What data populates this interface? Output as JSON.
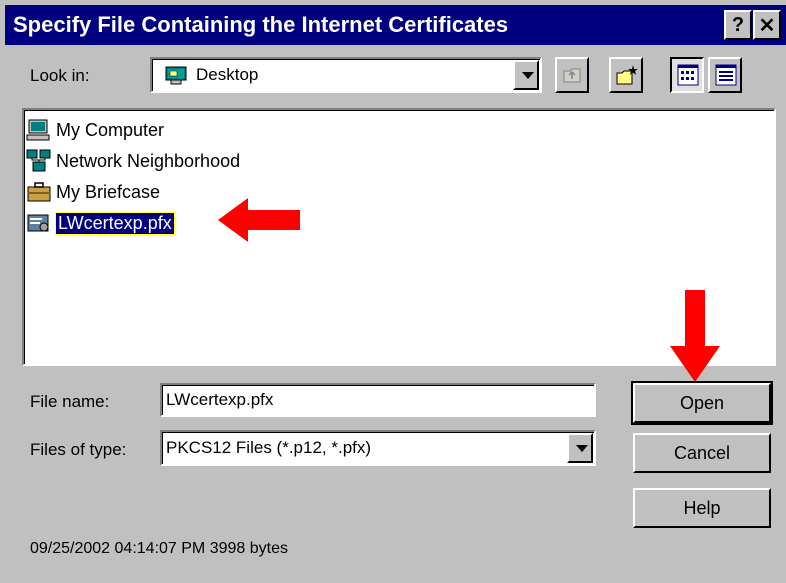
{
  "title": "Specify File Containing the Internet Certificates",
  "title_buttons": {
    "help": "?",
    "close": "✕"
  },
  "look_in": {
    "label": "Look in:",
    "value": "Desktop",
    "icon": "desktop-icon"
  },
  "toolbar": {
    "icons": [
      "up-folder-icon",
      "new-folder-icon",
      "list-view-icon",
      "details-view-icon"
    ]
  },
  "files": [
    {
      "name": "My Computer",
      "icon": "computer-icon"
    },
    {
      "name": "Network Neighborhood",
      "icon": "network-icon"
    },
    {
      "name": "My Briefcase",
      "icon": "briefcase-icon"
    },
    {
      "name": "LWcertexp.pfx",
      "icon": "certificate-icon",
      "selected": true
    }
  ],
  "file_name": {
    "label": "File name:",
    "value": "LWcertexp.pfx"
  },
  "files_of_type": {
    "label": "Files of type:",
    "value": "PKCS12 Files (*.p12, *.pfx)"
  },
  "buttons": {
    "open": "Open",
    "cancel": "Cancel",
    "help": "Help"
  },
  "status": "09/25/2002 04:14:07 PM 3998 bytes",
  "colors": {
    "titlebar": "#000080",
    "dialog": "#c0c0c0",
    "arrow": "#ff0000",
    "selection": "#000080"
  }
}
